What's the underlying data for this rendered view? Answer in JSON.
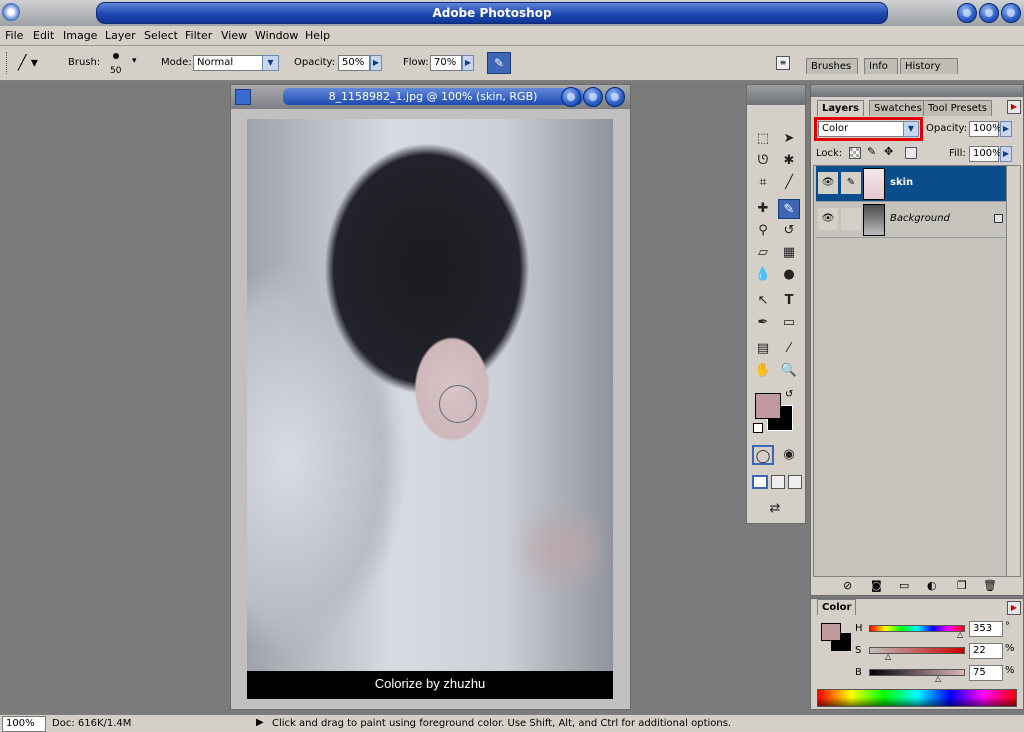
{
  "app": {
    "title": "Adobe Photoshop"
  },
  "menu": [
    "File",
    "Edit",
    "Image",
    "Layer",
    "Select",
    "Filter",
    "View",
    "Window",
    "Help"
  ],
  "options": {
    "brush_label": "Brush:",
    "brush_size": "50",
    "mode_label": "Mode:",
    "mode_value": "Normal",
    "opacity_label": "Opacity:",
    "opacity_value": "50%",
    "flow_label": "Flow:",
    "flow_value": "70%"
  },
  "palette_well": {
    "tabs": [
      "Brushes",
      "Info",
      "History"
    ]
  },
  "document": {
    "title": "8_1158982_1.jpg @ 100% (skin, RGB)",
    "caption": "Colorize by zhuzhu"
  },
  "layers_panel": {
    "tabs": [
      "Layers",
      "Swatches",
      "Tool Presets"
    ],
    "blend_mode": "Color",
    "opacity_label": "Opacity:",
    "opacity_value": "100%",
    "lock_label": "Lock:",
    "fill_label": "Fill:",
    "fill_value": "100%",
    "layers": [
      {
        "name": "skin",
        "selected": true
      },
      {
        "name": "Background",
        "locked": true
      }
    ]
  },
  "color_panel": {
    "tab": "Color",
    "h_label": "H",
    "h_value": "353",
    "h_unit": "°",
    "s_label": "S",
    "s_value": "22",
    "s_unit": "%",
    "b_label": "B",
    "b_value": "75",
    "b_unit": "%",
    "foreground": "#c09a9e",
    "background": "#000000"
  },
  "status": {
    "zoom": "100%",
    "doc_info": "Doc: 616K/1.4M",
    "hint": "Click and drag to paint using foreground color.  Use Shift, Alt, and Ctrl for additional options."
  },
  "colors": {
    "accent": "#1e4bb3",
    "selected_layer": "#0a4d8c",
    "highlight_box": "#e00000"
  }
}
